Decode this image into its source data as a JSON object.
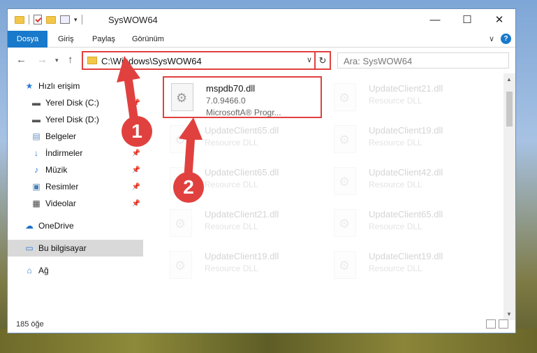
{
  "window": {
    "title": "SysWOW64",
    "controls": [
      "—",
      "☐",
      "✕"
    ]
  },
  "ribbon": {
    "tabs": [
      "Dosya",
      "Giriş",
      "Paylaş",
      "Görünüm"
    ],
    "help": "?"
  },
  "nav": {
    "address": "C:\\Windows\\SysWOW64",
    "search_placeholder": "Ara: SysWOW64"
  },
  "sidebar": {
    "items": [
      {
        "label": "Hızlı erişim",
        "icon": "star-icon"
      },
      {
        "label": "Yerel Disk (C:)",
        "icon": "drive-icon"
      },
      {
        "label": "Yerel Disk (D:)",
        "icon": "drive-icon"
      },
      {
        "label": "Belgeler",
        "icon": "documents-icon"
      },
      {
        "label": "İndirmeler",
        "icon": "downloads-icon"
      },
      {
        "label": "Müzik",
        "icon": "music-icon"
      },
      {
        "label": "Resimler",
        "icon": "pictures-icon"
      },
      {
        "label": "Videolar",
        "icon": "videos-icon"
      },
      {
        "label": "OneDrive",
        "icon": "cloud-icon"
      },
      {
        "label": "Bu bilgisayar",
        "icon": "computer-icon"
      },
      {
        "label": "Ağ",
        "icon": "network-icon"
      }
    ]
  },
  "files": {
    "highlighted": {
      "name": "mspdb70.dll",
      "version": "7.0.9466.0",
      "company": "MicrosoftA® Progr..."
    },
    "others": [
      {
        "name": "UpdateClient21.dll",
        "type": "Resource DLL"
      },
      {
        "name": "UpdateClient65.dll",
        "type": "Resource DLL"
      },
      {
        "name": "UpdateClient19.dll",
        "type": "Resource DLL"
      },
      {
        "name": "UpdateClient65.dll",
        "type": "Resource DLL"
      },
      {
        "name": "UpdateClient42.dll",
        "type": "Resource DLL"
      },
      {
        "name": "UpdateClient21.dll",
        "type": "Resource DLL"
      },
      {
        "name": "UpdateClient65.dll",
        "type": "Resource DLL"
      },
      {
        "name": "UpdateClient19.dll",
        "type": "Resource DLL"
      },
      {
        "name": "UpdateClient19.dll",
        "type": "Resource DLL"
      }
    ]
  },
  "status": {
    "count": "185 öğe"
  },
  "markers": [
    "1",
    "2"
  ],
  "colors": {
    "accent": "#1979ca",
    "annotation": "#e0413f"
  }
}
